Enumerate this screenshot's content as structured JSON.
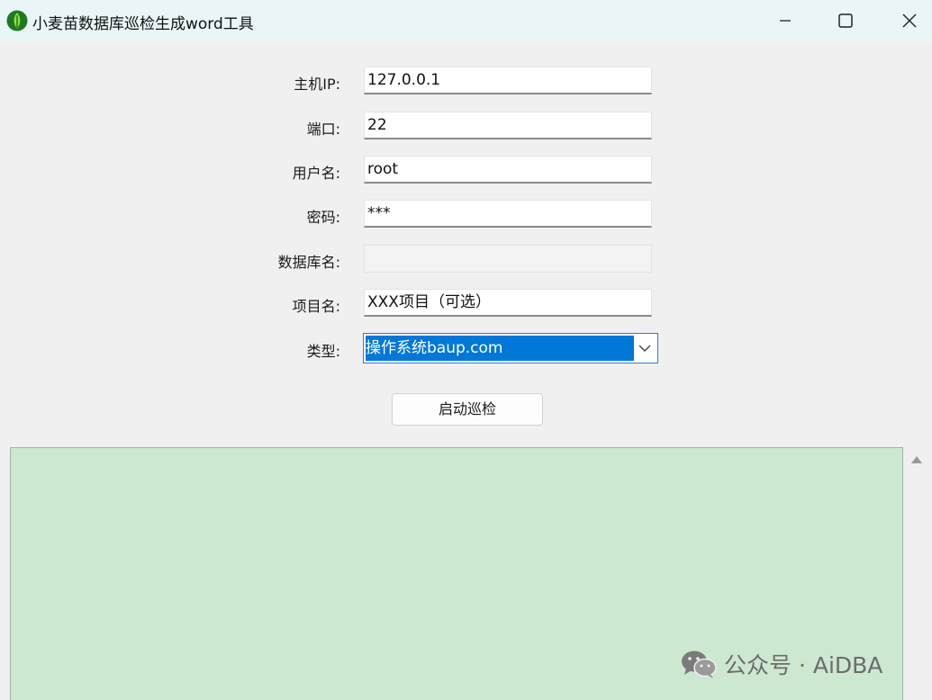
{
  "window": {
    "title": "小麦苗数据库巡检生成word工具",
    "controls": [
      "minimize",
      "maximize",
      "close"
    ]
  },
  "form": {
    "host_label": "主机IP:",
    "host_value": "127.0.0.1",
    "port_label": "端口:",
    "port_value": "22",
    "user_label": "用户名:",
    "user_value": "root",
    "password_label": "密码:",
    "password_value": "***",
    "dbname_label": "数据库名:",
    "dbname_value": "",
    "project_label": "项目名:",
    "project_value": "XXX项目（可选）",
    "type_label": "类型:",
    "type_value": "操作系统baup.com"
  },
  "actions": {
    "start_label": "启动巡检"
  },
  "output": {
    "text": ""
  },
  "watermark": {
    "text": "公众号 · AiDBA"
  },
  "colors": {
    "titlebar_bg": "#e9f5f7",
    "window_bg": "#f0f0f0",
    "selection_bg": "#0078d7",
    "output_bg": "#cde8d1"
  }
}
